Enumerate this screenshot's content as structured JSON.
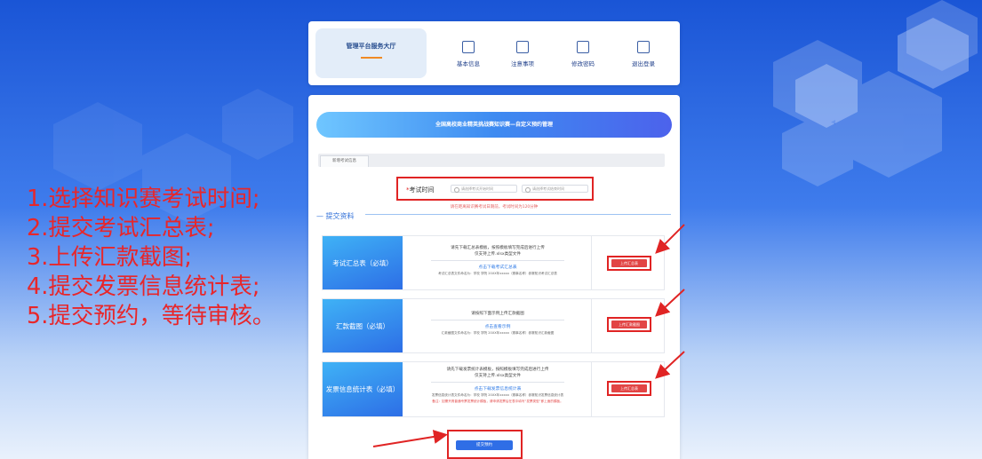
{
  "instructions": [
    "1.选择知识赛考试时间;",
    "2.提交考试汇总表;",
    "3.上传汇款截图;",
    "4.提交发票信息统计表;",
    "5.提交预约，等待审核。"
  ],
  "nav": {
    "home_title": "管理平台服务大厅",
    "items": [
      {
        "label": "基本信息",
        "icon": "id-card-icon"
      },
      {
        "label": "注意事项",
        "icon": "calendar-note-icon"
      },
      {
        "label": "修改密码",
        "icon": "edit-icon"
      },
      {
        "label": "退出登录",
        "icon": "logout-icon"
      }
    ]
  },
  "main": {
    "banner": "全国高校商业精英挑战赛知识赛—自定义预约管理",
    "tab": "新增考试信息",
    "exam": {
      "label": "考试时间",
      "start_placeholder": "请选择考试开始时间",
      "end_placeholder": "请选择考试结束时间",
      "hint": "请在距离知识赛考试日期前，考试时间为120分钟"
    },
    "section_title": "提交资料",
    "rows": [
      {
        "label": "考试汇总表（必填）",
        "desc1": "请先下载汇总表模板，按照模板填写完成后进行上传",
        "desc2": "仅支持上传.xlsx类型文件",
        "link": "点击下载考试汇总表",
        "note": "考试汇总表文件命名为：学校 学院 20XX年xxxxx（赛事名称）参赛知识考试汇总表",
        "warn": "",
        "button": "上传汇总表"
      },
      {
        "label": "汇款截图（必填）",
        "desc1": "请按照下面示例上传汇款截图",
        "desc2": "",
        "link": "点击查看示例",
        "note": "汇款截图文件命名为：学校 学院 20XX年xxxxx（赛事名称）参赛知识汇款截图",
        "warn": "",
        "button": "上传汇款截图"
      },
      {
        "label": "发票信息统计表（必填）",
        "desc1": "请先下载发票统计表模板，按照模板填写完成后进行上传",
        "desc2": "仅支持上传.xlsx类型文件",
        "link": "点击下载发票信息统计表",
        "note": "发票信息统计表文件命名为：学校 学院 20XX年xxxxx（赛事名称）参赛知识发票信息统计表",
        "warn": "备注：如需开具普通专票发票统计模板，请申请发票后在表中填写“发票类型”即上面的模板。",
        "button": "上传汇总表"
      }
    ],
    "submit": "提交预约"
  },
  "colors": {
    "accent_red": "#e02424",
    "primary_blue": "#2f6ee6"
  }
}
